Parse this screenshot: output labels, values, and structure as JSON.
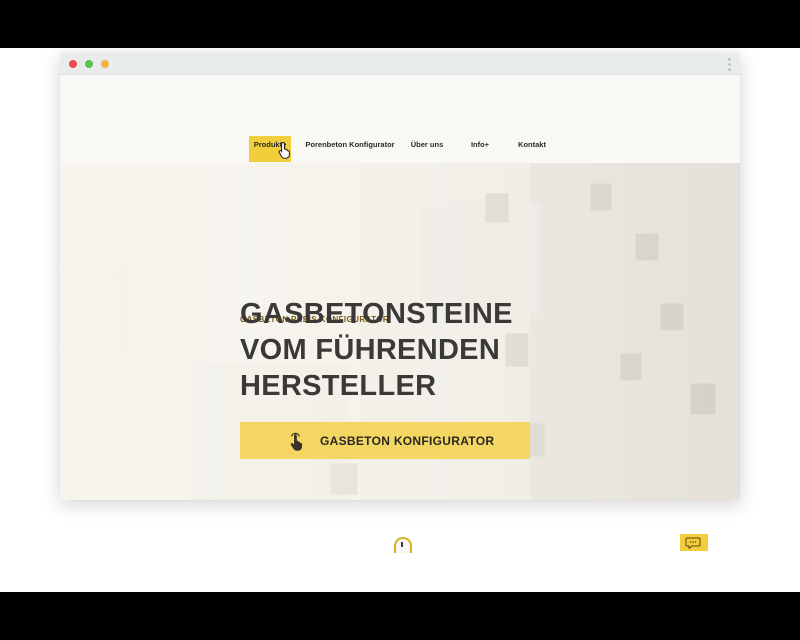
{
  "nav": {
    "items": [
      {
        "label": "Produkte",
        "active": true
      },
      {
        "label": "Porenbeton Konfigurator",
        "active": false
      },
      {
        "label": "Über uns",
        "active": false
      },
      {
        "label": "Info+",
        "active": false
      },
      {
        "label": "Kontakt",
        "active": false
      }
    ]
  },
  "hero": {
    "eyebrow": "GASBETON PREIS KONFIGURATOR",
    "headline_line1": "GASBETONSTEINE",
    "headline_line2": "VOM FÜHRENDEN",
    "headline_line3": "HERSTELLER",
    "cta_label": "GASBETON KONFIGURATOR",
    "background_digits": "01"
  },
  "colors": {
    "accent": "#f2cd3c",
    "cta": "#f4d763",
    "headline": "#3a3936",
    "eyebrow": "#7a5a10"
  },
  "icons": {
    "cursor": "hand-pointer-icon",
    "cta": "hand-touch-icon",
    "scroll": "mouse-scroll-icon",
    "chat": "chat-bubble-icon"
  }
}
